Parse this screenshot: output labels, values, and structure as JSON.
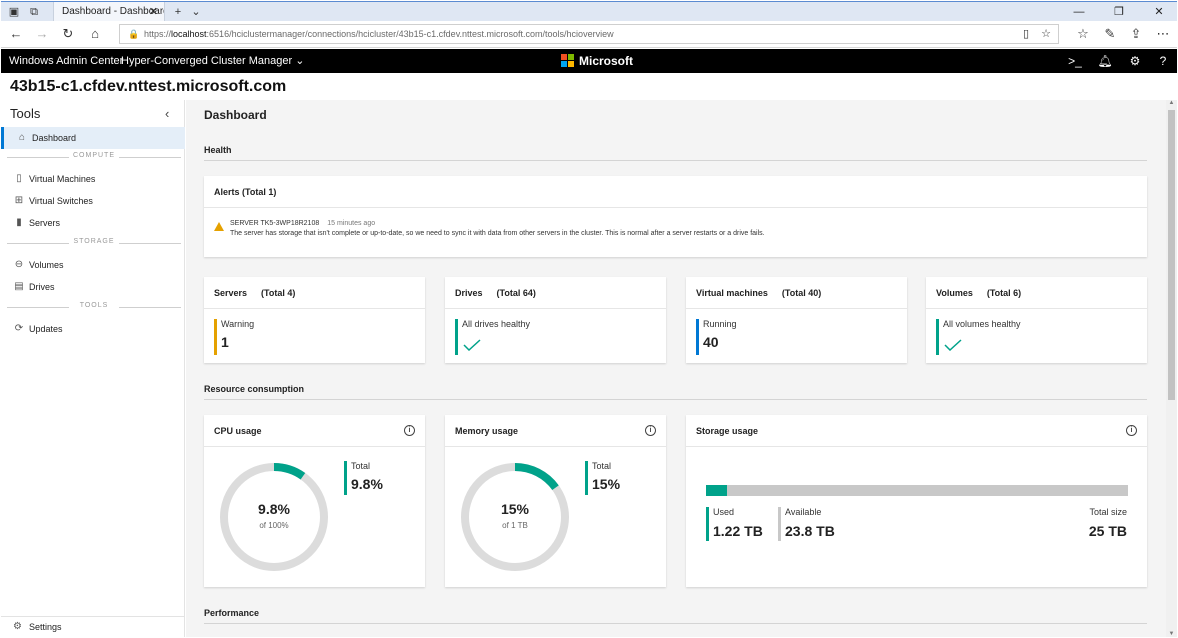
{
  "browser": {
    "tab_title": "Dashboard - Dashboard",
    "url_prefix": "https://",
    "url_host": "localhost",
    "url_rest": ":6516/hciclustermanager/connections/hcicluster/43b15-c1.cfdev.nttest.microsoft.com/tools/hcioverview"
  },
  "header": {
    "app_title": "Windows Admin Center",
    "tool_menu": "Hyper-Converged Cluster Manager",
    "brand": "Microsoft",
    "colors": {
      "ms_red": "#f25022",
      "ms_green": "#7fba00",
      "ms_blue": "#00a4ef",
      "ms_yellow": "#ffb900"
    }
  },
  "connection_title": "43b15-c1.cfdev.nttest.microsoft.com",
  "sidebar": {
    "title": "Tools",
    "dashboard": "Dashboard",
    "section_compute": "COMPUTE",
    "virtual_machines": "Virtual Machines",
    "virtual_switches": "Virtual Switches",
    "servers": "Servers",
    "section_storage": "STORAGE",
    "volumes": "Volumes",
    "drives": "Drives",
    "section_tools": "TOOLS",
    "updates": "Updates",
    "settings": "Settings"
  },
  "main": {
    "title": "Dashboard",
    "health_heading": "Health",
    "alerts": {
      "title": "Alerts (Total 1)",
      "source": "SERVER TK5-3WP18R2108",
      "time": "15 minutes ago",
      "message": "The server has storage that isn't complete or up-to-date, so we need to sync it with data from other servers in the cluster. This is normal after a server restarts or a drive fails."
    },
    "servers": {
      "title": "Servers",
      "total": "(Total 4)",
      "label": "Warning",
      "value": "1"
    },
    "drives": {
      "title": "Drives",
      "total": "(Total 64)",
      "label": "All drives healthy"
    },
    "vms": {
      "title": "Virtual machines",
      "total": "(Total 40)",
      "label": "Running",
      "value": "40"
    },
    "volumes": {
      "title": "Volumes",
      "total": "(Total 6)",
      "label": "All volumes healthy"
    },
    "resource_heading": "Resource consumption",
    "cpu": {
      "title": "CPU usage",
      "value": "9.8%",
      "sub": "of 100%",
      "total_label": "Total",
      "total_value": "9.8%",
      "fraction": 0.098
    },
    "memory": {
      "title": "Memory usage",
      "value": "15%",
      "sub": "of 1 TB",
      "total_label": "Total",
      "total_value": "15%",
      "fraction": 0.15
    },
    "storage": {
      "title": "Storage usage",
      "used_label": "Used",
      "used_value": "1.22 TB",
      "available_label": "Available",
      "available_value": "23.8 TB",
      "total_label": "Total size",
      "total_value": "25 TB",
      "fraction": 0.049
    },
    "performance_heading": "Performance"
  },
  "colors": {
    "teal": "#00a28a",
    "warning": "#e5a100",
    "running": "#0078d4",
    "accent": "#0078d4"
  }
}
